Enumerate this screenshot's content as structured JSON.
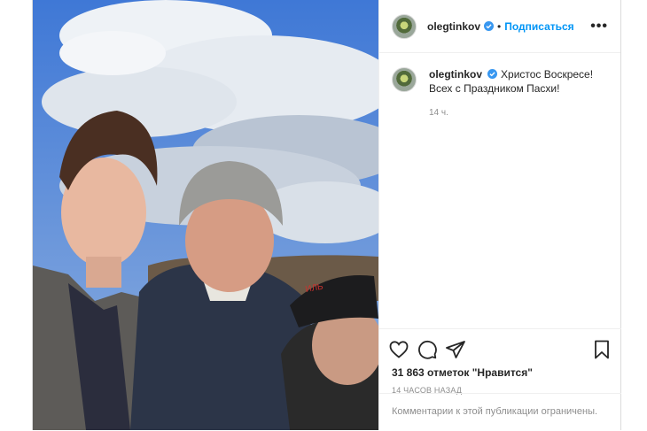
{
  "post": {
    "username": "olegtinkov",
    "verified": true,
    "separator": "•",
    "follow_label": "Подписаться",
    "more_label": "•••",
    "caption_line1": "Христос Воскресе!",
    "caption_line2": "Всех с Праздником Пасхи!",
    "caption_time": "14 ч.",
    "likes_text": "31 863 отметок \"Нравится\"",
    "date_text": "14 ЧАСОВ НАЗАД",
    "comments_notice": "Комментарии к этой публикации ограничены.",
    "photo_description_icon": "selfie-photo",
    "icons": {
      "like": "heart-icon",
      "comment": "comment-bubble-icon",
      "share": "paper-plane-icon",
      "save": "bookmark-icon",
      "verified": "verified-badge-icon"
    },
    "colors": {
      "link": "#0095f6",
      "secondary": "#8e8e8e",
      "text": "#262626",
      "verified": "#3897f0"
    }
  }
}
